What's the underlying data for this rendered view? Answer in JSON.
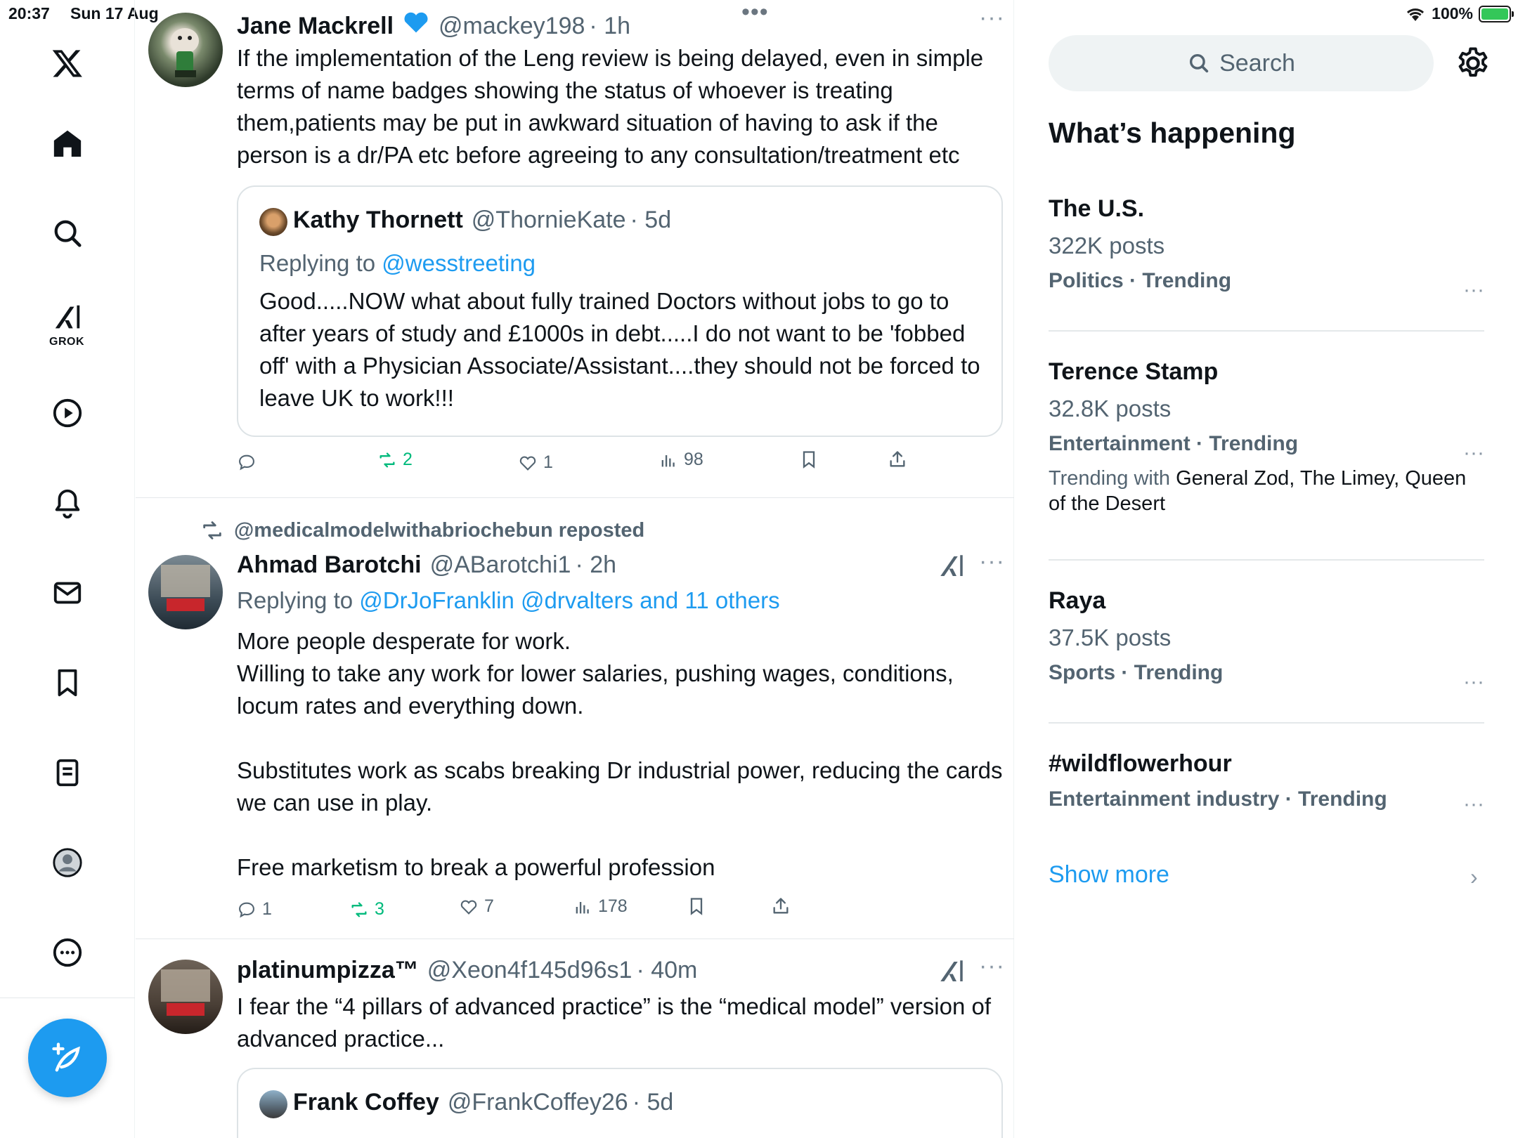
{
  "status_bar": {
    "time": "20:37",
    "date": "Sun 17 Aug",
    "battery": "100%"
  },
  "nav": {
    "grok_label": "GROK"
  },
  "tweets": [
    {
      "name": "Jane Mackrell",
      "handle": "@mackey198",
      "time": "· 1h",
      "text": "If the implementation of the Leng review is being delayed, even in simple terms of name badges showing the status of whoever is treating them,patients may be put in awkward situation of having to ask if the person is a dr/PA etc before agreeing to any consultation/treatment etc",
      "quote": {
        "name": "Kathy Thornett",
        "handle": "@ThornieKate",
        "time": "· 5d",
        "replying_prefix": "Replying to",
        "replying_to": "@wesstreeting",
        "text": "Good.....NOW what about fully trained Doctors without jobs to go to after years of study and £1000s in debt.....I do not want to be 'fobbed off' with a Physician Associate/Assistant....they should not be forced to leave UK to work!!!"
      },
      "stats": {
        "replies": "",
        "reposts": "2",
        "likes": "1",
        "views": "98"
      }
    },
    {
      "reposted_by": "@medicalmodelwithabriochebun reposted",
      "name": "Ahmad Barotchi",
      "handle": "@ABarotchi1",
      "time": "· 2h",
      "replying_prefix": "Replying to",
      "replying_to": "@DrJoFranklin @drvalters and 11 others",
      "text": "More people desperate for work.\nWilling to take any work for lower salaries, pushing wages, conditions, locum rates and everything down.\n\nSubstitutes work as scabs breaking Dr industrial power, reducing the cards we can use in play.\n\nFree marketism to break a powerful profession",
      "stats": {
        "replies": "1",
        "reposts": "3",
        "likes": "7",
        "views": "178"
      }
    },
    {
      "name": "platinumpizza™",
      "handle": "@Xeon4f145d96s1",
      "time": "· 40m",
      "text": "I fear the “4 pillars of advanced practice” is the “medical model” version of advanced practice...",
      "quote": {
        "name": "Frank Coffey",
        "handle": "@FrankCoffey26",
        "time": "· 5d"
      }
    }
  ],
  "sidebar": {
    "search_placeholder": "Search",
    "title": "What’s happening",
    "trends": [
      {
        "name": "The U.S.",
        "count": "322K posts",
        "category": "Politics · Trending"
      },
      {
        "name": "Terence Stamp",
        "count": "32.8K posts",
        "category": "Entertainment · Trending",
        "with_prefix": "Trending with",
        "with": "General Zod, The Limey, Queen of the Desert"
      },
      {
        "name": "Raya",
        "count": "37.5K posts",
        "category": "Sports · Trending"
      },
      {
        "name": "#wildflowerhour",
        "category": "Entertainment industry · Trending"
      }
    ],
    "show_more": "Show more"
  },
  "colors": {
    "accent": "#1d9bf0",
    "repost_green": "#00ba7c",
    "secondary_text": "#536471"
  }
}
